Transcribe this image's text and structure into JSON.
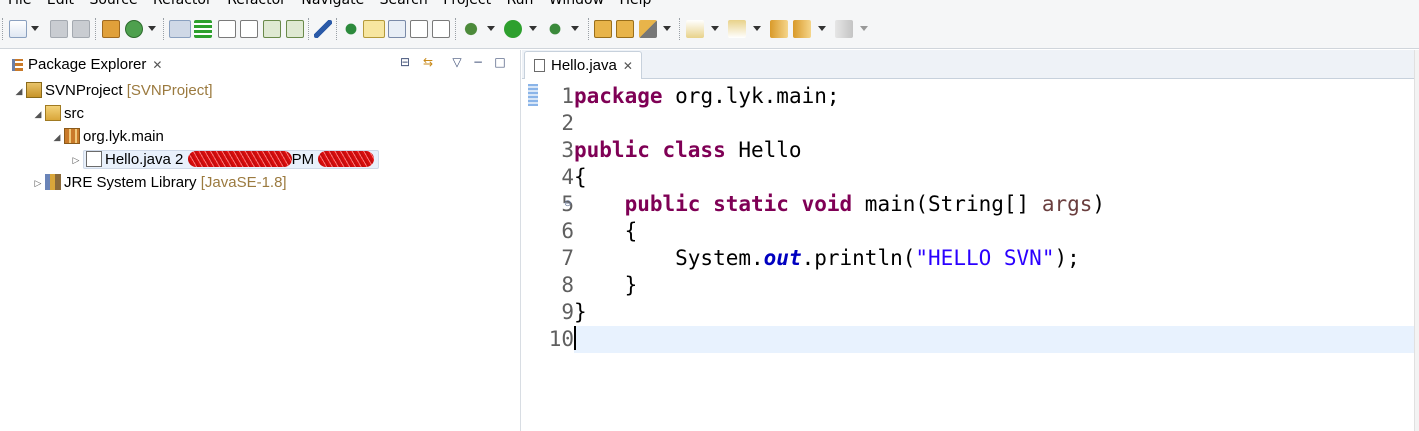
{
  "menu": [
    "File",
    "Edit",
    "Source",
    "Refactor",
    "Refactor",
    "Navigate",
    "Search",
    "Project",
    "Run",
    "Window",
    "Help"
  ],
  "colors": {
    "keyword": "#7f0055",
    "string": "#2a00ff",
    "field": "#0000c0",
    "current_line": "#e8f2fe",
    "tab_active_bg": "#ffffff"
  },
  "package_explorer": {
    "title": "Package Explorer",
    "close_icon": "close-icon",
    "tools": [
      "collapse-all-icon",
      "link-with-editor-icon",
      "view-menu-icon",
      "minimize-icon",
      "maximize-icon"
    ],
    "tree": {
      "project": {
        "label": "SVNProject",
        "decoration": "[SVNProject]"
      },
      "src": {
        "label": "src"
      },
      "package": {
        "label": "org.lyk.main"
      },
      "file": {
        "label": "Hello.java 2",
        "time_suffix": "PM"
      },
      "jre": {
        "label": "JRE System Library",
        "decoration": "[JavaSE-1.8]"
      }
    }
  },
  "editor": {
    "tab_label": "Hello.java",
    "line_numbers": [
      "1",
      "2",
      "3",
      "4",
      "5",
      "6",
      "7",
      "8",
      "9",
      "10"
    ],
    "code": {
      "l1": {
        "kw": "package",
        "rest": " org.lyk.main;"
      },
      "l3": {
        "kw": "public class",
        "rest": " Hello"
      },
      "l4": "{",
      "l5": {
        "indent": "    ",
        "kw": "public static void",
        "mid": " main(String[] ",
        "arg": "args",
        "end": ")"
      },
      "l6": "    {",
      "l7": {
        "pre": "        System.",
        "field": "out",
        "mid": ".println(",
        "str": "\"HELLO SVN\"",
        "end": ");"
      },
      "l8": "    }",
      "l9": "}"
    }
  }
}
